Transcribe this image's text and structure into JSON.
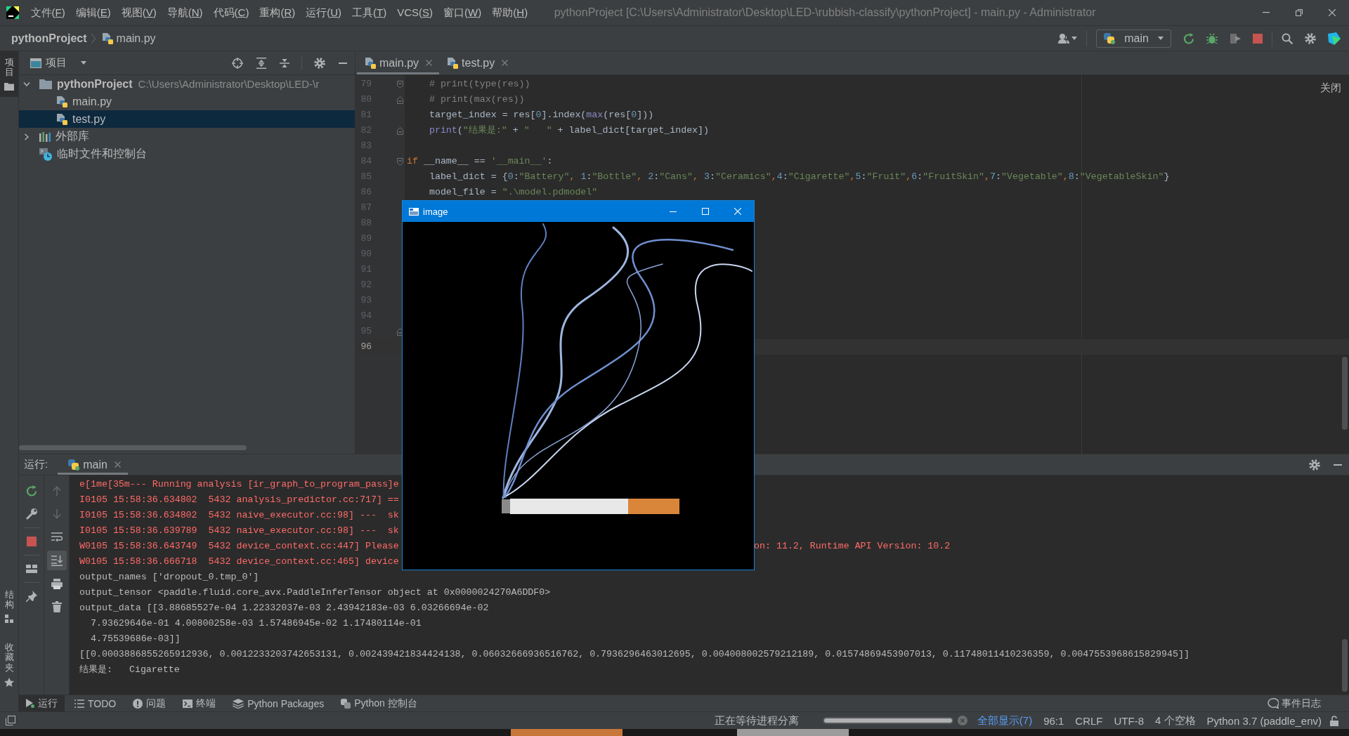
{
  "window": {
    "title": "pythonProject [C:\\Users\\Administrator\\Desktop\\LED-\\rubbish-classify\\pythonProject] - main.py - Administrator"
  },
  "menu": [
    "文件(F)",
    "编辑(E)",
    "视图(V)",
    "导航(N)",
    "代码(C)",
    "重构(R)",
    "运行(U)",
    "工具(T)",
    "VCS(S)",
    "窗口(W)",
    "帮助(H)"
  ],
  "navigation": {
    "breadcrumb": [
      {
        "label": "pythonProject",
        "kind": "project"
      },
      {
        "label": "main.py",
        "kind": "python_file"
      }
    ],
    "run_configuration": {
      "label": "main",
      "running": true
    }
  },
  "side_strip": {
    "top": [
      {
        "label": "项目",
        "kind": "project",
        "selected": true
      }
    ],
    "bottom": [
      {
        "label": "结构",
        "kind": "structure",
        "selected": false
      },
      {
        "label": "收藏夹",
        "kind": "favorites",
        "selected": false
      }
    ]
  },
  "project_panel": {
    "title": "项目",
    "tree": [
      {
        "label": "pythonProject",
        "kind": "project",
        "path": "C:\\Users\\Administrator\\Desktop\\LED-\\r",
        "expanded": true,
        "selected": false,
        "children": [
          {
            "label": "main.py",
            "kind": "python",
            "selected": false
          },
          {
            "label": "test.py",
            "kind": "python",
            "selected": true
          }
        ]
      },
      {
        "label": "外部库",
        "kind": "library",
        "expanded": false,
        "selected": false
      },
      {
        "label": "临时文件和控制台",
        "kind": "scratch",
        "selected": false
      }
    ]
  },
  "editor": {
    "tabs": [
      {
        "label": "main.py",
        "selected": true
      },
      {
        "label": "test.py",
        "selected": false
      }
    ],
    "hint": "关闭",
    "lines": [
      {
        "number": "79",
        "fold": {
          "kind": "start"
        },
        "current": false,
        "tokens": [
          {
            "kind": "comment",
            "text": "    # print(type(res))"
          }
        ]
      },
      {
        "number": "80",
        "fold": {
          "kind": "end"
        },
        "current": false,
        "tokens": [
          {
            "kind": "comment",
            "text": "    # print(max(res))"
          }
        ]
      },
      {
        "number": "81",
        "current": false,
        "tokens": [
          {
            "kind": "plain",
            "text": "    target_index = res["
          },
          {
            "kind": "number",
            "text": "0"
          },
          {
            "kind": "plain",
            "text": "].index("
          },
          {
            "kind": "builtin",
            "text": "max"
          },
          {
            "kind": "plain",
            "text": "(res["
          },
          {
            "kind": "number",
            "text": "0"
          },
          {
            "kind": "plain",
            "text": "]))"
          }
        ]
      },
      {
        "number": "82",
        "fold": {
          "kind": "end"
        },
        "current": false,
        "tokens": [
          {
            "kind": "builtin",
            "text": "    print"
          },
          {
            "kind": "plain",
            "text": "("
          },
          {
            "kind": "string",
            "text": "\"结果是:\""
          },
          {
            "kind": "plain",
            "text": " + "
          },
          {
            "kind": "string",
            "text": "\"   \""
          },
          {
            "kind": "plain",
            "text": " + label_dict[target_index])"
          }
        ]
      },
      {
        "number": "83",
        "current": false
      },
      {
        "number": "84",
        "fold": {
          "kind": "start"
        },
        "current": false,
        "tokens": [
          {
            "kind": "keyword",
            "text": "if"
          },
          {
            "kind": "plain",
            "text": " __name__ == "
          },
          {
            "kind": "string",
            "text": "'__main__'"
          },
          {
            "kind": "plain",
            "text": ":"
          }
        ]
      },
      {
        "number": "85",
        "current": false,
        "tokens": [
          {
            "kind": "plain",
            "text": "    label_dict = {"
          },
          {
            "kind": "number",
            "text": "0"
          },
          {
            "kind": "plain",
            "text": ":"
          },
          {
            "kind": "string",
            "text": "\"Battery\""
          },
          {
            "kind": "comma",
            "text": ", "
          },
          {
            "kind": "number",
            "text": "1"
          },
          {
            "kind": "plain",
            "text": ":"
          },
          {
            "kind": "string",
            "text": "\"Bottle\""
          },
          {
            "kind": "comma",
            "text": ", "
          },
          {
            "kind": "number",
            "text": "2"
          },
          {
            "kind": "plain",
            "text": ":"
          },
          {
            "kind": "string",
            "text": "\"Cans\""
          },
          {
            "kind": "comma",
            "text": ", "
          },
          {
            "kind": "number",
            "text": "3"
          },
          {
            "kind": "plain",
            "text": ":"
          },
          {
            "kind": "string",
            "text": "\"Ceramics\""
          },
          {
            "kind": "comma",
            "text": ","
          },
          {
            "kind": "number",
            "text": "4"
          },
          {
            "kind": "plain",
            "text": ":"
          },
          {
            "kind": "string",
            "text": "\"Cigarette\""
          },
          {
            "kind": "comma",
            "text": ","
          },
          {
            "kind": "number",
            "text": "5"
          },
          {
            "kind": "plain",
            "text": ":"
          },
          {
            "kind": "string",
            "text": "\"Fruit\""
          },
          {
            "kind": "comma",
            "text": ","
          },
          {
            "kind": "number",
            "text": "6"
          },
          {
            "kind": "plain",
            "text": ":"
          },
          {
            "kind": "string",
            "text": "\"FruitSkin\""
          },
          {
            "kind": "comma",
            "text": ","
          },
          {
            "kind": "number",
            "text": "7"
          },
          {
            "kind": "plain",
            "text": ":"
          },
          {
            "kind": "string",
            "text": "\"Vegetable\""
          },
          {
            "kind": "comma",
            "text": ","
          },
          {
            "kind": "number",
            "text": "8"
          },
          {
            "kind": "plain",
            "text": ":"
          },
          {
            "kind": "string",
            "text": "\"VegetableSkin\""
          },
          {
            "kind": "plain",
            "text": "}"
          }
        ]
      },
      {
        "number": "86",
        "current": false,
        "tokens": [
          {
            "kind": "plain",
            "text": "    model_file = "
          },
          {
            "kind": "string",
            "text": "\".\\model.pdmodel\""
          }
        ]
      },
      {
        "number": "87",
        "current": false
      },
      {
        "number": "88",
        "current": false
      },
      {
        "number": "89",
        "current": false
      },
      {
        "number": "90",
        "current": false
      },
      {
        "number": "91",
        "current": false
      },
      {
        "number": "92",
        "current": false
      },
      {
        "number": "93",
        "current": false
      },
      {
        "number": "94",
        "current": false
      },
      {
        "number": "95",
        "fold": {
          "kind": "end"
        },
        "current": false
      },
      {
        "number": "96",
        "current": true
      }
    ]
  },
  "image_window": {
    "title": "image"
  },
  "run_panel": {
    "label": "运行:",
    "tabs": [
      {
        "label": "main",
        "selected": true,
        "running": true
      }
    ],
    "actions": [
      {
        "kind": "rerun"
      },
      {
        "kind": "settings"
      },
      {
        "kind": "stop"
      },
      {
        "kind": "layout"
      },
      {
        "kind": "pin"
      }
    ],
    "console_actions": [
      {
        "kind": "up",
        "disabled": true,
        "selected": false
      },
      {
        "kind": "down",
        "disabled": true,
        "selected": false
      },
      {
        "kind": "wrap",
        "disabled": false,
        "selected": false
      },
      {
        "kind": "scroll_end",
        "disabled": false,
        "selected": true
      },
      {
        "kind": "print",
        "disabled": false,
        "selected": false
      },
      {
        "kind": "clear",
        "disabled": false,
        "selected": false
      }
    ],
    "console": [
      {
        "kind": "stderr",
        "text": "e[1me[35m--- Running analysis [ir_graph_to_program_pass]e"
      },
      {
        "kind": "stderr",
        "text": "I0105 15:58:36.634802  5432 analysis_predictor.cc:717] =="
      },
      {
        "kind": "stderr",
        "text": "I0105 15:58:36.634802  5432 naive_executor.cc:98] ---  sk"
      },
      {
        "kind": "stderr",
        "text": "I0105 15:58:36.639789  5432 naive_executor.cc:98] ---  sk"
      },
      {
        "kind": "stderr",
        "text": "W0105 15:58:36.643749  5432 device_context.cc:447] Please",
        "tail": "on: 11.2, Runtime API Version: 10.2"
      },
      {
        "kind": "stderr",
        "text": "W0105 15:58:36.666718  5432 device_context.cc:465] device"
      },
      {
        "kind": "stdout",
        "text": "output_names ['dropout_0.tmp_0']"
      },
      {
        "kind": "stdout",
        "text": "output_tensor <paddle.fluid.core_avx.PaddleInferTensor object at 0x0000024270A6DDF0>"
      },
      {
        "kind": "stdout",
        "text": "output_data [[3.88685527e-04 1.22332037e-03 2.43942183e-03 6.03266694e-02"
      },
      {
        "kind": "stdout",
        "text": "  7.93629646e-01 4.00800258e-03 1.57486945e-02 1.17480114e-01"
      },
      {
        "kind": "stdout",
        "text": "  4.75539686e-03]]"
      },
      {
        "kind": "stdout",
        "text": "[[0.0003886855265912936, 0.0012233203742653131, 0.002439421834424138, 0.06032666936516762, 0.7936296463012695, 0.004008002579212189, 0.01574869453907013, 0.11748011410236359, 0.0047553968615829945]]"
      },
      {
        "kind": "stdout",
        "text": "结果是:   Cigarette"
      }
    ]
  },
  "tool_window_bar": {
    "tabs": [
      {
        "label": "运行",
        "kind": "run",
        "selected": true
      },
      {
        "label": "TODO",
        "kind": "todo",
        "selected": false
      },
      {
        "label": "问题",
        "kind": "problems",
        "selected": false
      },
      {
        "label": "终端",
        "kind": "terminal",
        "selected": false
      },
      {
        "label": "Python Packages",
        "kind": "packages",
        "selected": false
      },
      {
        "label": "Python 控制台",
        "kind": "console",
        "selected": false
      }
    ],
    "event_log": "事件日志"
  },
  "status_bar": {
    "task": "正在等待进程分离",
    "progress": {
      "level": 1
    },
    "show_all": "全部显示(7)",
    "items": [
      "96:1",
      "CRLF",
      "UTF-8",
      "4 个空格",
      "Python 3.7 (paddle_env)"
    ]
  }
}
